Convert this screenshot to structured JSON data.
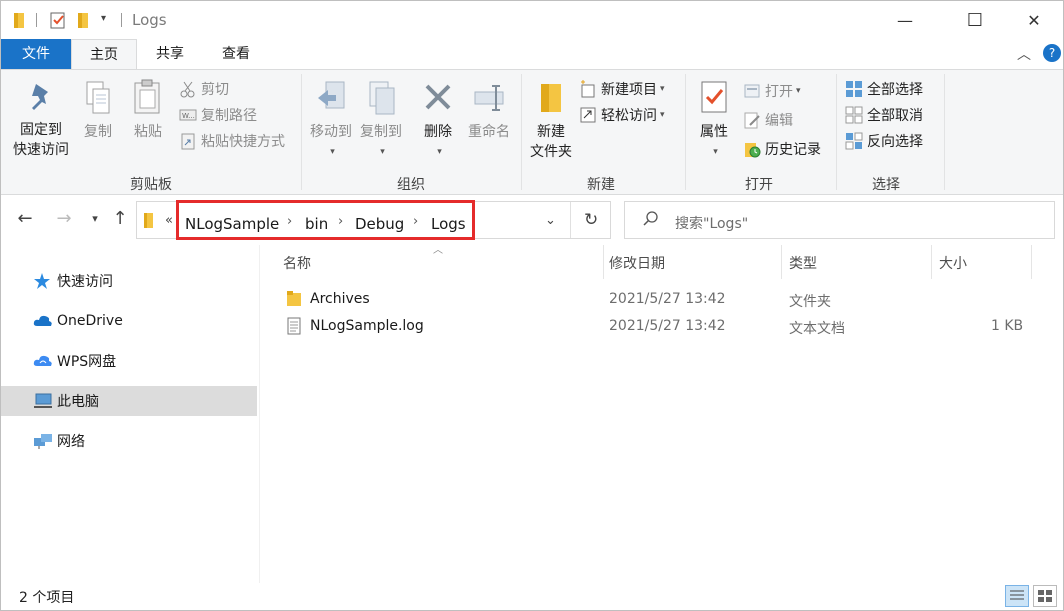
{
  "window": {
    "title": "Logs",
    "minimize": "—",
    "maximize": "☐",
    "close": "✕"
  },
  "tabs": {
    "file": "文件",
    "home": "主页",
    "share": "共享",
    "view": "查看"
  },
  "ribbon": {
    "clipboard": {
      "label": "剪贴板",
      "pin_line1": "固定到",
      "pin_line2": "快速访问",
      "copy": "复制",
      "paste": "粘贴",
      "cut": "剪切",
      "copy_path": "复制路径",
      "paste_shortcut": "粘贴快捷方式"
    },
    "organize": {
      "label": "组织",
      "move_to": "移动到",
      "copy_to": "复制到",
      "delete": "删除",
      "rename": "重命名"
    },
    "new": {
      "label": "新建",
      "new_folder_line1": "新建",
      "new_folder_line2": "文件夹",
      "new_item": "新建项目",
      "easy_access": "轻松访问"
    },
    "open": {
      "label": "打开",
      "properties": "属性",
      "open": "打开",
      "edit": "编辑",
      "history": "历史记录"
    },
    "select": {
      "label": "选择",
      "select_all": "全部选择",
      "select_none": "全部取消",
      "invert": "反向选择"
    }
  },
  "address": {
    "overflow": "«",
    "crumbs": [
      "NLogSample",
      "bin",
      "Debug",
      "Logs"
    ],
    "search_placeholder": "搜索\"Logs\""
  },
  "nav": {
    "items": [
      {
        "label": "快速访问",
        "icon": "star-icon"
      },
      {
        "label": "OneDrive",
        "icon": "cloud-icon"
      },
      {
        "label": "WPS网盘",
        "icon": "wps-cloud-icon"
      },
      {
        "label": "此电脑",
        "icon": "computer-icon",
        "selected": true
      },
      {
        "label": "网络",
        "icon": "network-icon"
      }
    ]
  },
  "columns": {
    "name": "名称",
    "modified": "修改日期",
    "type": "类型",
    "size": "大小"
  },
  "files": [
    {
      "name": "Archives",
      "modified": "2021/5/27 13:42",
      "type": "文件夹",
      "size": "",
      "icon": "folder-icon"
    },
    {
      "name": "NLogSample.log",
      "modified": "2021/5/27 13:42",
      "type": "文本文档",
      "size": "1 KB",
      "icon": "document-icon"
    }
  ],
  "status": {
    "count": "2 个项目"
  },
  "colors": {
    "accent": "#1a73c8",
    "highlight_border": "#e52b2b",
    "selected_nav": "#dcdcdc"
  }
}
